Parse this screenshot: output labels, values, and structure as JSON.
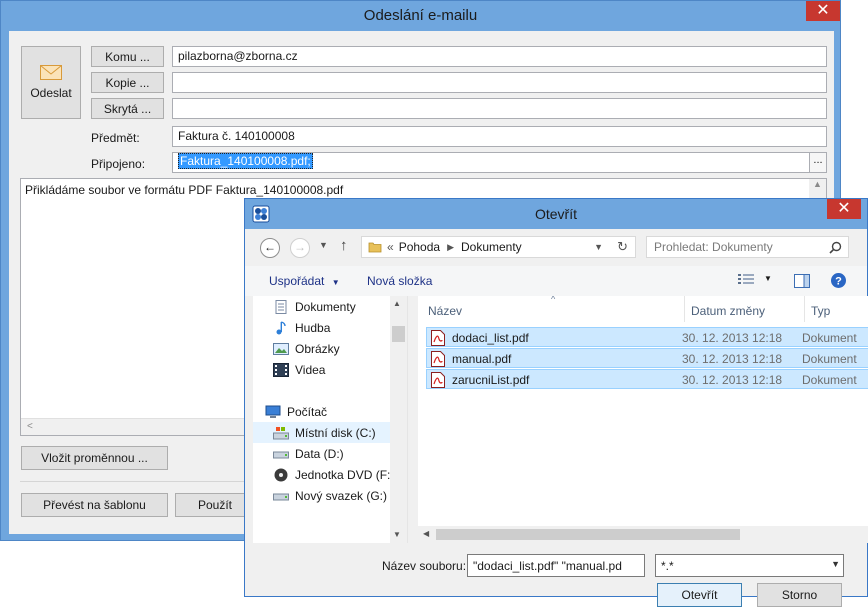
{
  "email_window": {
    "title": "Odeslání e-mailu",
    "close_glyph": "✕",
    "send_button": "Odeslat",
    "to_button": "Komu ...",
    "cc_button": "Kopie ...",
    "bcc_button": "Skrytá ...",
    "to_value": "pilazborna@zborna.cz",
    "cc_value": "",
    "bcc_value": "",
    "subject_label": "Předmět:",
    "subject_value": "Faktura č. 140100008",
    "attached_label": "Připojeno:",
    "attached_value": "Faktura_140100008.pdf;",
    "browse_glyph": "...",
    "body_text": "Přikládáme soubor ve formátu PDF Faktura_140100008.pdf",
    "insert_variable_button": "Vložit proměnnou ...",
    "convert_template_button": "Převést na šablonu",
    "use_button": "Použít"
  },
  "open_dialog": {
    "title": "Otevřít",
    "close_glyph": "✕",
    "breadcrumb_prefix": "«",
    "breadcrumb": [
      "Pohoda",
      "Dokumenty"
    ],
    "search_placeholder": "Prohledat: Dokumenty",
    "toolbar": {
      "organize": "Uspořádat",
      "new_folder": "Nová složka"
    },
    "nav_items": [
      {
        "label": "Dokumenty",
        "icon": "documents-icon"
      },
      {
        "label": "Hudba",
        "icon": "music-icon"
      },
      {
        "label": "Obrázky",
        "icon": "pictures-icon"
      },
      {
        "label": "Videa",
        "icon": "videos-icon"
      },
      {
        "label": "Počítač",
        "icon": "computer-icon"
      },
      {
        "label": "Místní disk (C:)",
        "icon": "drive-icon"
      },
      {
        "label": "Data (D:)",
        "icon": "drive-icon"
      },
      {
        "label": "Jednotka DVD (F:",
        "icon": "dvd-icon"
      },
      {
        "label": "Nový svazek (G:)",
        "icon": "drive-icon"
      }
    ],
    "columns": {
      "name": "Název",
      "date": "Datum změny",
      "type": "Typ"
    },
    "files": [
      {
        "name": "dodaci_list.pdf",
        "date": "30. 12. 2013 12:18",
        "type": "Dokument"
      },
      {
        "name": "manual.pdf",
        "date": "30. 12. 2013 12:18",
        "type": "Dokument"
      },
      {
        "name": "zarucniList.pdf",
        "date": "30. 12. 2013 12:18",
        "type": "Dokument"
      }
    ],
    "filename_label": "Název souboru:",
    "filename_value": "\"dodaci_list.pdf\" \"manual.pd",
    "filter_value": "*.*",
    "open_button": "Otevřít",
    "cancel_button": "Storno"
  },
  "colors": {
    "title_bar": "#6fa6de",
    "close_button": "#c7372f",
    "selection": "#cce8ff",
    "link_text": "#1e3287"
  }
}
